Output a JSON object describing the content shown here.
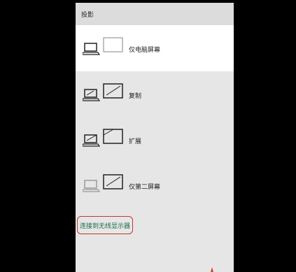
{
  "flyout": {
    "title": "投影",
    "options": [
      {
        "id": "pc-only",
        "label": "仅电脑屏幕",
        "icon": "pc-screen-only-icon"
      },
      {
        "id": "duplicate",
        "label": "复制",
        "icon": "duplicate-icon"
      },
      {
        "id": "extend",
        "label": "扩展",
        "icon": "extend-icon"
      },
      {
        "id": "second-only",
        "label": "仅第二屏幕",
        "icon": "second-screen-only-icon"
      }
    ],
    "selected_option": "pc-only",
    "connect_link": "连接到无线显示器"
  },
  "colors": {
    "page_background": "#000000",
    "flyout_background": "#e6e6e6",
    "selected_background": "#ffffff",
    "link_color": "#1a6a4a",
    "highlight_border": "#c0392b"
  }
}
